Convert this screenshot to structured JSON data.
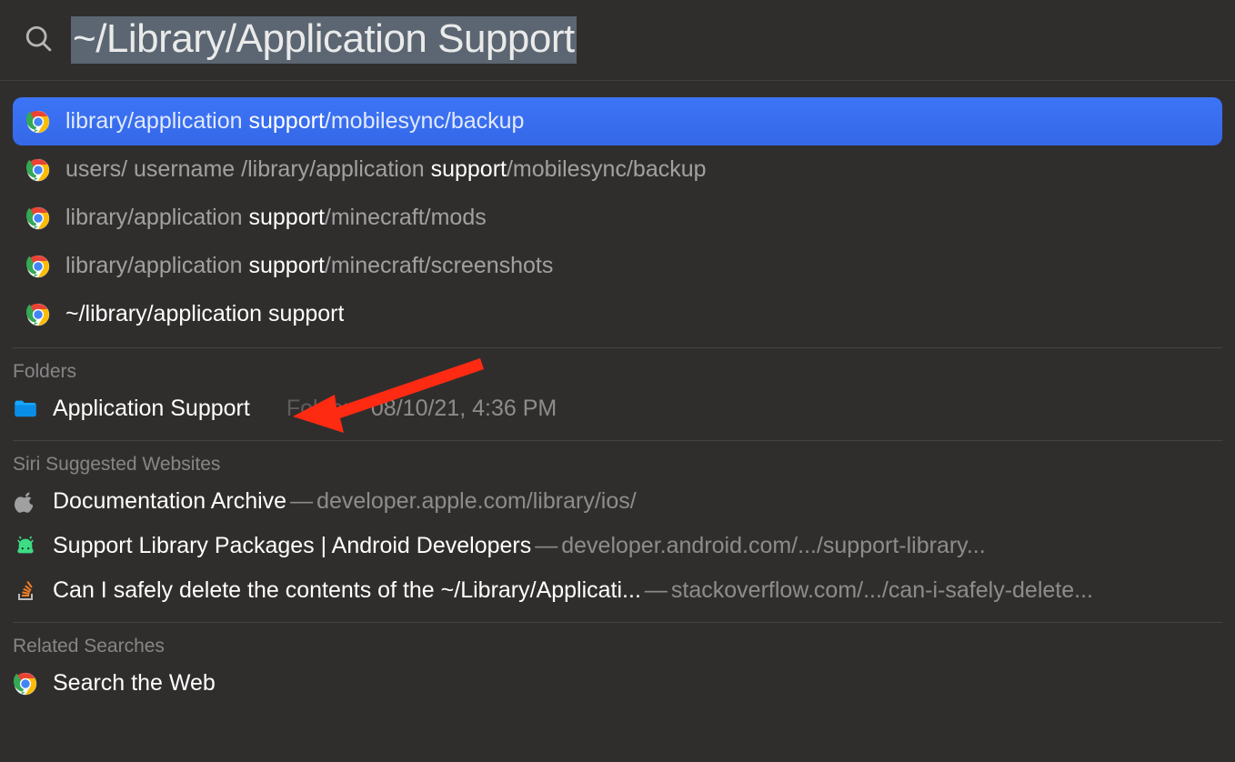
{
  "search": {
    "query": "~/Library/Application Support",
    "selected": true
  },
  "top_hits": [
    {
      "icon": "chrome",
      "pre": "library/application ",
      "hl": "support",
      "post": "/mobilesync/backup",
      "selected": true
    },
    {
      "icon": "chrome",
      "pre": "users/ username /library/application ",
      "hl": "support",
      "post": "/mobilesync/backup",
      "selected": false
    },
    {
      "icon": "chrome",
      "pre": "library/application ",
      "hl": "support",
      "post": "/minecraft/mods",
      "selected": false
    },
    {
      "icon": "chrome",
      "pre": "library/application ",
      "hl": "support",
      "post": "/minecraft/screenshots",
      "selected": false
    },
    {
      "icon": "chrome",
      "pre": "",
      "hl": "~/library/application support",
      "post": "",
      "selected": false
    }
  ],
  "sections": {
    "folders": {
      "header": "Folders",
      "items": [
        {
          "icon": "folder",
          "name": "Application Support",
          "kind": "Folder",
          "sep": " · ",
          "date": "08/10/21, 4:36 PM"
        }
      ]
    },
    "siri_sites": {
      "header": "Siri Suggested Websites",
      "items": [
        {
          "icon": "apple",
          "title": "Documentation Archive",
          "dash": " — ",
          "url": "developer.apple.com/library/ios/"
        },
        {
          "icon": "android",
          "title": "Support Library Packages | Android Developers",
          "dash": " — ",
          "url": "developer.android.com/.../support-library..."
        },
        {
          "icon": "stackoverflow",
          "title": "Can I safely delete the contents of the ~/Library/Applicati...",
          "dash": " — ",
          "url": "stackoverflow.com/.../can-i-safely-delete..."
        }
      ]
    },
    "related": {
      "header": "Related Searches",
      "items": [
        {
          "icon": "chrome",
          "label": "Search the Web"
        }
      ]
    }
  }
}
